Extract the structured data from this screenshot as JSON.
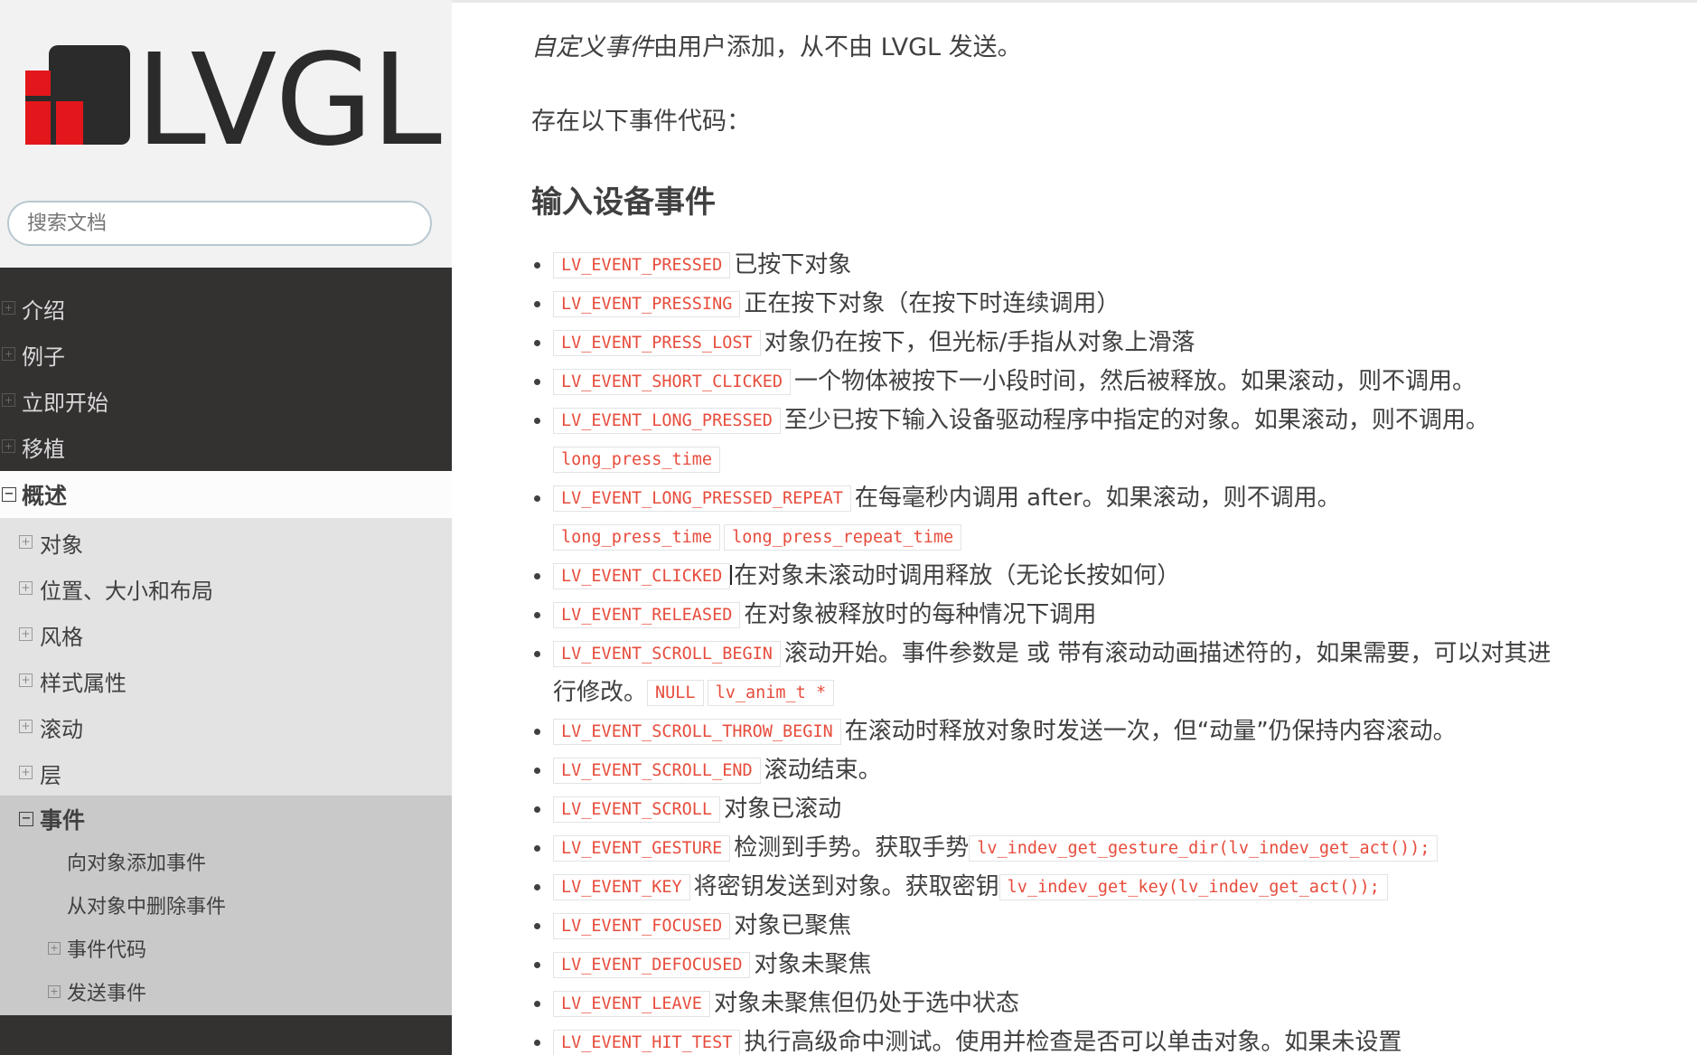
{
  "brand": {
    "name": "LVGL",
    "logo_colors": {
      "red": "#e3171b",
      "dark": "#2b2b2b"
    }
  },
  "search": {
    "placeholder": "搜索文档"
  },
  "nav": {
    "top_items": [
      "介绍",
      "例子",
      "立即开始",
      "移植"
    ],
    "current": "概述",
    "sub_items": [
      "对象",
      "位置、大小和布局",
      "风格",
      "样式属性",
      "滚动",
      "层"
    ],
    "events_section": {
      "label": "事件",
      "children": [
        {
          "label": "向对象添加事件",
          "toggle": false
        },
        {
          "label": "从对象中删除事件",
          "toggle": false
        },
        {
          "label": "事件代码",
          "toggle": true
        },
        {
          "label": "发送事件",
          "toggle": true
        }
      ]
    }
  },
  "content": {
    "intro_em": "自定义事件",
    "intro_rest": "由用户添加，从不由 LVGL 发送。",
    "codes_text": "存在以下事件代码：",
    "section_title": "输入设备事件",
    "events": [
      {
        "code": "LV_EVENT_PRESSED",
        "desc": "已按下对象"
      },
      {
        "code": "LV_EVENT_PRESSING",
        "desc": "正在按下对象（在按下时连续调用）"
      },
      {
        "code": "LV_EVENT_PRESS_LOST",
        "desc": "对象仍在按下，但光标/手指从对象上滑落"
      },
      {
        "code": "LV_EVENT_SHORT_CLICKED",
        "desc": "一个物体被按下一小段时间，然后被释放。如果滚动，则不调用。"
      },
      {
        "code": "LV_EVENT_LONG_PRESSED",
        "desc": "至少已按下输入设备驱动程序中指定的对象。如果滚动，则不调用。",
        "extra_codes": [
          "long_press_time"
        ]
      },
      {
        "code": "LV_EVENT_LONG_PRESSED_REPEAT",
        "desc": "在每毫秒内调用 after。如果滚动，则不调用。",
        "extra_codes": [
          "long_press_time",
          "long_press_repeat_time"
        ]
      },
      {
        "code": "LV_EVENT_CLICKED",
        "desc": "在对象未滚动时调用释放（无论长按如何）"
      },
      {
        "code": "LV_EVENT_RELEASED",
        "desc": "在对象被释放时的每种情况下调用"
      },
      {
        "code": "LV_EVENT_SCROLL_BEGIN",
        "desc": "滚动开始。事件参数是 或 带有滚动动画描述符的，如果需要，可以对其进",
        "cont": "行修改。",
        "extra_codes": [
          "NULL",
          "lv_anim_t *"
        ]
      },
      {
        "code": "LV_EVENT_SCROLL_THROW_BEGIN",
        "desc": "在滚动时释放对象时发送一次，但“动量”仍保持内容滚动。"
      },
      {
        "code": "LV_EVENT_SCROLL_END",
        "desc": "滚动结束。"
      },
      {
        "code": "LV_EVENT_SCROLL",
        "desc": "对象已滚动"
      },
      {
        "code": "LV_EVENT_GESTURE",
        "desc": "检测到手势。获取手势",
        "tail_code": "lv_indev_get_gesture_dir(lv_indev_get_act());"
      },
      {
        "code": "LV_EVENT_KEY",
        "desc": "将密钥发送到对象。获取密钥",
        "tail_code": "lv_indev_get_key(lv_indev_get_act());"
      },
      {
        "code": "LV_EVENT_FOCUSED",
        "desc": "对象已聚焦"
      },
      {
        "code": "LV_EVENT_DEFOCUSED",
        "desc": "对象未聚焦"
      },
      {
        "code": "LV_EVENT_LEAVE",
        "desc": "对象未聚焦但仍处于选中状态"
      },
      {
        "code": "LV_EVENT_HIT_TEST",
        "desc": "执行高级命中测试。使用并检查是否可以单击对象。如果未设置"
      }
    ]
  },
  "colors": {
    "sidebar_dark": "#343131",
    "code_red": "#e74c3c",
    "text": "#404040"
  }
}
